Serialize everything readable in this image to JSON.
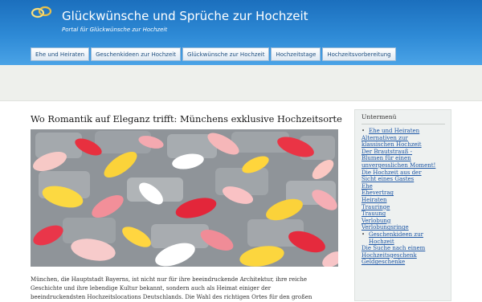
{
  "header": {
    "title": "Glückwünsche und Sprüche zur Hochzeit",
    "tagline": "Portal für Glückwünsche zur Hochzeit",
    "logo_icon": "wedding-rings-icon"
  },
  "nav": {
    "items": [
      {
        "label": "Ehe und Heiraten"
      },
      {
        "label": "Geschenkideen zur Hochzeit"
      },
      {
        "label": "Glückwünsche zur Hochzeit"
      },
      {
        "label": "Hochzeitstage"
      },
      {
        "label": "Hochzeitsvorbereitung"
      }
    ]
  },
  "article": {
    "title": "Wo Romantik auf Eleganz trifft: Münchens exklusive Hochzeitsorte",
    "image_icon": "rose-petals-on-cobblestones-image",
    "lines": [
      "München, die Hauptstadt Bayerns, ist nicht nur für ihre beeindruckende Architektur, ihre reiche",
      "Geschichte und ihre lebendige Kultur bekannt, sondern auch als Heimat einiger der",
      "beeindruckendsten Hochzeitslocations Deutschlands. Die Wahl des richtigen Ortes für den großen"
    ]
  },
  "sidebar": {
    "heading": "Untermenü",
    "items": [
      {
        "label": "Ehe und Heiraten",
        "level": 0
      },
      {
        "label": "Alternativen zur",
        "level": 1
      },
      {
        "label": "klassischen Hochzeit",
        "level": 1
      },
      {
        "label": "Der Brautstrauß -",
        "level": 1
      },
      {
        "label": "Blumen für einen",
        "level": 1
      },
      {
        "label": "unvergesslichen Moment!",
        "level": 1
      },
      {
        "label": "Die Hochzeit aus der",
        "level": 1
      },
      {
        "label": "Sicht eines Gastes",
        "level": 1
      },
      {
        "label": "Ehe",
        "level": 1
      },
      {
        "label": "Ehevertrag",
        "level": 1
      },
      {
        "label": "Heiraten",
        "level": 1
      },
      {
        "label": "Trauringe",
        "level": 1
      },
      {
        "label": "Trauung",
        "level": 1
      },
      {
        "label": "Verlobung",
        "level": 1
      },
      {
        "label": "Verlobungsringe",
        "level": 1
      },
      {
        "label": "Geschenkideen zur",
        "level": 0
      },
      {
        "label": "Hochzeit",
        "level": 0
      },
      {
        "label": "Die Suche nach einem",
        "level": 1
      },
      {
        "label": "Hochzeitsgeschenk",
        "level": 1
      },
      {
        "label": "Geldgeschenke",
        "level": 1
      }
    ]
  }
}
